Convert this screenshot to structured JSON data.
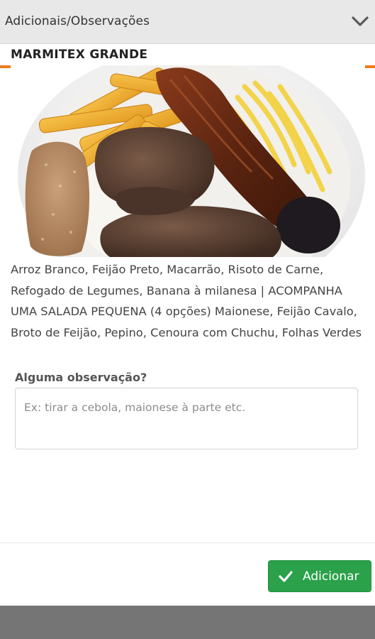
{
  "modal": {
    "title": "Adicionais/Observações",
    "collapse_icon": "chevron-down-icon"
  },
  "product": {
    "name": "MARMITEX GRANDE",
    "image_alt": "Marmitex com arroz, batata frita, macarrão, costela e carne",
    "description": "Arroz Branco, Feijão Preto, Macarrão, Risoto de Carne, Refogado de Legumes, Banana à milanesa | ACOMPANHA UMA SALADA PEQUENA (4 opções) Maionese, Feijão Cavalo, Broto de Feijão, Pepino, Cenoura com Chuchu, Folhas Verdes"
  },
  "observation": {
    "label": "Alguma observação?",
    "placeholder": "Ex: tirar a cebola, maionese à parte etc.",
    "value": ""
  },
  "footer": {
    "add_button_label": "Adicionar",
    "add_button_icon": "check-icon"
  },
  "colors": {
    "header_bg": "#e8e8e8",
    "accent_orange": "#f07c1c",
    "button_green": "#2aa14a",
    "backdrop": "#757575"
  }
}
